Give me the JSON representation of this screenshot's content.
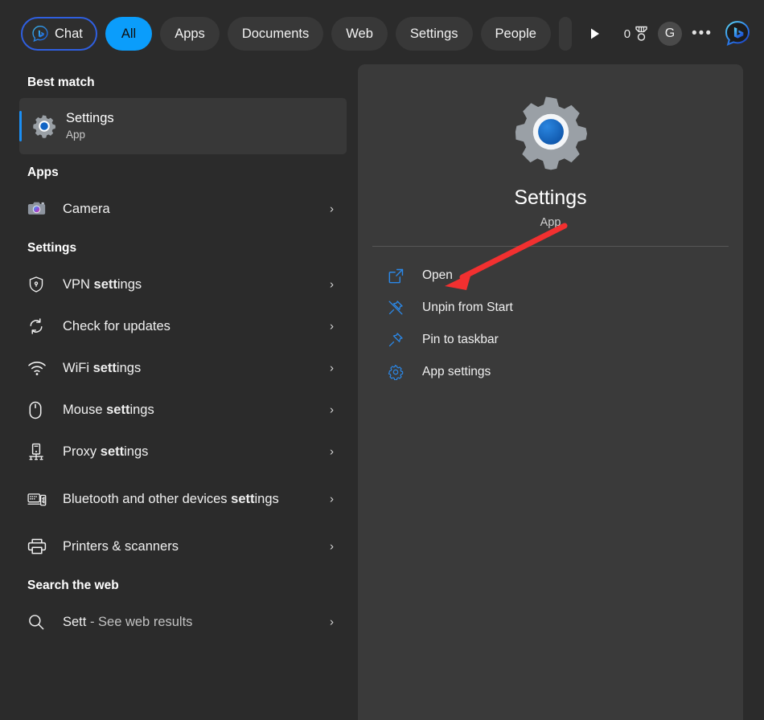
{
  "topbar": {
    "chat_tab": "Chat",
    "tabs": [
      {
        "label": "All",
        "active": true
      },
      {
        "label": "Apps",
        "active": false
      },
      {
        "label": "Documents",
        "active": false
      },
      {
        "label": "Web",
        "active": false
      },
      {
        "label": "Settings",
        "active": false
      },
      {
        "label": "People",
        "active": false
      }
    ],
    "overflow_label": "▶",
    "rewards_count": "0",
    "account_initial": "G",
    "more_label": "•••"
  },
  "search_query": "Sett",
  "left": {
    "best_match_header": "Best match",
    "best_match": {
      "title": "Settings",
      "subtitle": "App",
      "icon": "settings-gear-icon"
    },
    "apps_header": "Apps",
    "apps": [
      {
        "label": "Camera",
        "icon": "camera-icon",
        "bold": ""
      }
    ],
    "settings_header": "Settings",
    "settings": [
      {
        "plain": "VPN ",
        "bold": "sett",
        "tail": "ings",
        "icon": "shield-lock-icon"
      },
      {
        "plain": "Check for updates",
        "bold": "",
        "tail": "",
        "icon": "sync-icon"
      },
      {
        "plain": "WiFi ",
        "bold": "sett",
        "tail": "ings",
        "icon": "wifi-icon"
      },
      {
        "plain": "Mouse ",
        "bold": "sett",
        "tail": "ings",
        "icon": "mouse-icon"
      },
      {
        "plain": "Proxy ",
        "bold": "sett",
        "tail": "ings",
        "icon": "proxy-icon"
      },
      {
        "plain": "Bluetooth and other devices ",
        "bold": "sett",
        "tail": "ings",
        "icon": "bluetooth-devices-icon"
      },
      {
        "plain": "Printers & scanners",
        "bold": "",
        "tail": "",
        "icon": "printer-icon"
      }
    ],
    "web_header": "Search the web",
    "web": [
      {
        "plain": "Sett",
        "suffix": " - See web results",
        "icon": "search-icon"
      }
    ],
    "chevron": "›"
  },
  "preview": {
    "title": "Settings",
    "subtitle": "App",
    "icon": "settings-gear-icon",
    "actions": [
      {
        "label": "Open",
        "icon": "open-external-icon"
      },
      {
        "label": "Unpin from Start",
        "icon": "unpin-icon"
      },
      {
        "label": "Pin to taskbar",
        "icon": "pin-icon"
      },
      {
        "label": "App settings",
        "icon": "gear-icon"
      }
    ]
  },
  "colors": {
    "page_bg": "#2b2b2b",
    "panel_bg": "#3a3a3a",
    "accent_blue": "#0b9dfb",
    "selection_bar": "#1b8ff5",
    "action_icon_blue": "#2b88e8",
    "annotation_red": "#f23030"
  }
}
